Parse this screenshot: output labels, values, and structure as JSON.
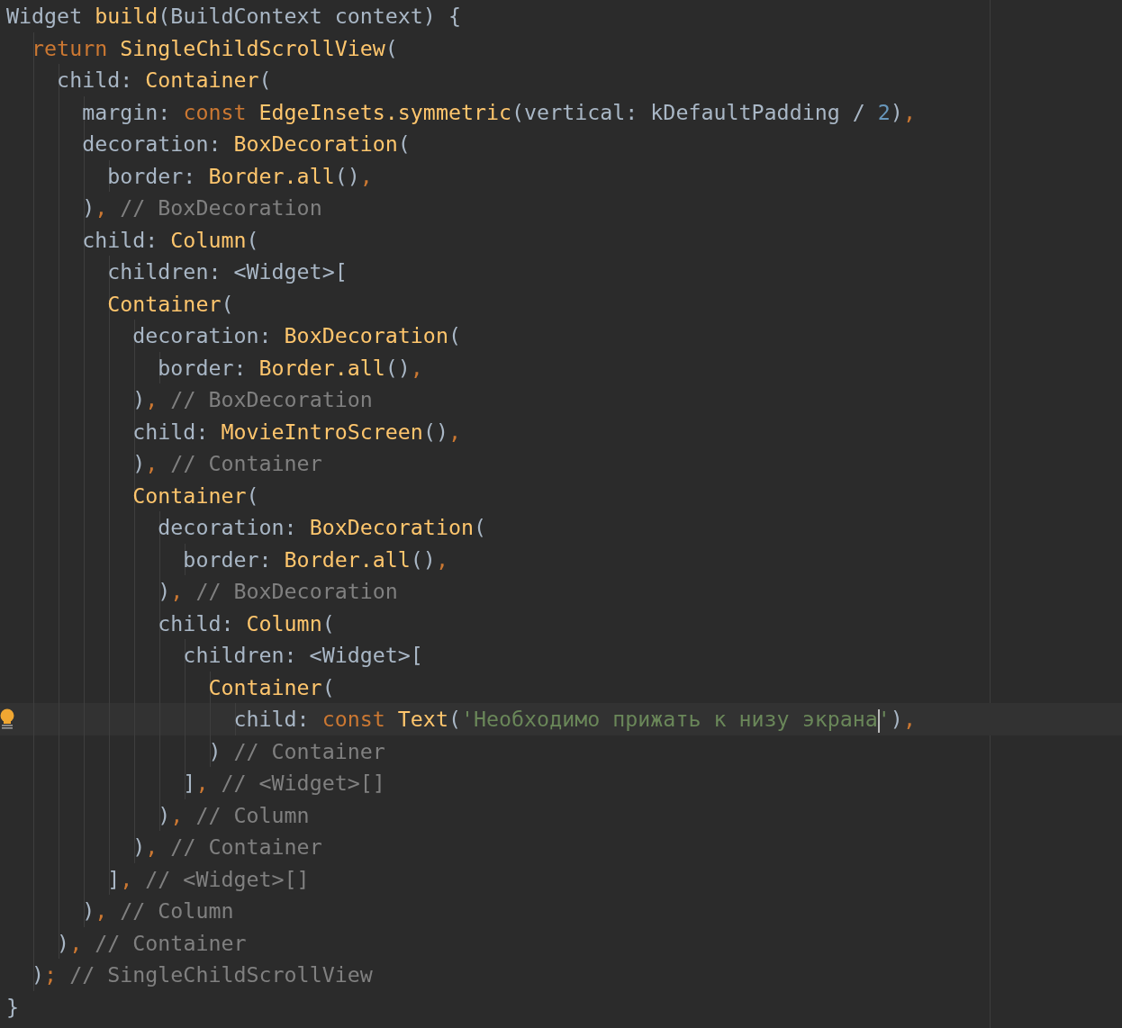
{
  "editor": {
    "lines": [
      {
        "current": false,
        "tokens": [
          {
            "kind": "plain",
            "text": "Widget "
          },
          {
            "kind": "func",
            "text": "build"
          },
          {
            "kind": "plain",
            "text": "(BuildContext context) {"
          }
        ]
      },
      {
        "current": false,
        "tokens": [
          {
            "kind": "kw",
            "text": "  return "
          },
          {
            "kind": "func",
            "text": "SingleChildScrollView"
          },
          {
            "kind": "plain",
            "text": "("
          }
        ]
      },
      {
        "current": false,
        "tokens": [
          {
            "kind": "plain",
            "text": "    child: "
          },
          {
            "kind": "func",
            "text": "Container"
          },
          {
            "kind": "plain",
            "text": "("
          }
        ]
      },
      {
        "current": false,
        "tokens": [
          {
            "kind": "plain",
            "text": "      margin: "
          },
          {
            "kind": "kw",
            "text": "const "
          },
          {
            "kind": "func",
            "text": "EdgeInsets.symmetric"
          },
          {
            "kind": "plain",
            "text": "(vertical: kDefaultPadding / "
          },
          {
            "kind": "num",
            "text": "2"
          },
          {
            "kind": "plain",
            "text": ")"
          },
          {
            "kind": "kw",
            "text": ","
          }
        ]
      },
      {
        "current": false,
        "tokens": [
          {
            "kind": "plain",
            "text": "      decoration: "
          },
          {
            "kind": "func",
            "text": "BoxDecoration"
          },
          {
            "kind": "plain",
            "text": "("
          }
        ]
      },
      {
        "current": false,
        "tokens": [
          {
            "kind": "plain",
            "text": "        border: "
          },
          {
            "kind": "func",
            "text": "Border.all"
          },
          {
            "kind": "plain",
            "text": "()"
          },
          {
            "kind": "kw",
            "text": ","
          }
        ]
      },
      {
        "current": false,
        "tokens": [
          {
            "kind": "plain",
            "text": "      )"
          },
          {
            "kind": "kw",
            "text": ","
          },
          {
            "kind": "comment",
            "text": " // BoxDecoration"
          }
        ]
      },
      {
        "current": false,
        "tokens": [
          {
            "kind": "plain",
            "text": "      child: "
          },
          {
            "kind": "func",
            "text": "Column"
          },
          {
            "kind": "plain",
            "text": "("
          }
        ]
      },
      {
        "current": false,
        "tokens": [
          {
            "kind": "plain",
            "text": "        children: <Widget>["
          }
        ]
      },
      {
        "current": false,
        "tokens": [
          {
            "kind": "func",
            "text": "        Container"
          },
          {
            "kind": "plain",
            "text": "("
          }
        ]
      },
      {
        "current": false,
        "tokens": [
          {
            "kind": "plain",
            "text": "          decoration: "
          },
          {
            "kind": "func",
            "text": "BoxDecoration"
          },
          {
            "kind": "plain",
            "text": "("
          }
        ]
      },
      {
        "current": false,
        "tokens": [
          {
            "kind": "plain",
            "text": "            border: "
          },
          {
            "kind": "func",
            "text": "Border.all"
          },
          {
            "kind": "plain",
            "text": "()"
          },
          {
            "kind": "kw",
            "text": ","
          }
        ]
      },
      {
        "current": false,
        "tokens": [
          {
            "kind": "plain",
            "text": "          )"
          },
          {
            "kind": "kw",
            "text": ","
          },
          {
            "kind": "comment",
            "text": " // BoxDecoration"
          }
        ]
      },
      {
        "current": false,
        "tokens": [
          {
            "kind": "plain",
            "text": "          child: "
          },
          {
            "kind": "func",
            "text": "MovieIntroScreen"
          },
          {
            "kind": "plain",
            "text": "()"
          },
          {
            "kind": "kw",
            "text": ","
          }
        ]
      },
      {
        "current": false,
        "tokens": [
          {
            "kind": "plain",
            "text": "          )"
          },
          {
            "kind": "kw",
            "text": ","
          },
          {
            "kind": "comment",
            "text": " // Container"
          }
        ]
      },
      {
        "current": false,
        "tokens": [
          {
            "kind": "func",
            "text": "          Container"
          },
          {
            "kind": "plain",
            "text": "("
          }
        ]
      },
      {
        "current": false,
        "tokens": [
          {
            "kind": "plain",
            "text": "            decoration: "
          },
          {
            "kind": "func",
            "text": "BoxDecoration"
          },
          {
            "kind": "plain",
            "text": "("
          }
        ]
      },
      {
        "current": false,
        "tokens": [
          {
            "kind": "plain",
            "text": "              border: "
          },
          {
            "kind": "func",
            "text": "Border.all"
          },
          {
            "kind": "plain",
            "text": "()"
          },
          {
            "kind": "kw",
            "text": ","
          }
        ]
      },
      {
        "current": false,
        "tokens": [
          {
            "kind": "plain",
            "text": "            )"
          },
          {
            "kind": "kw",
            "text": ","
          },
          {
            "kind": "comment",
            "text": " // BoxDecoration"
          }
        ]
      },
      {
        "current": false,
        "tokens": [
          {
            "kind": "plain",
            "text": "            child: "
          },
          {
            "kind": "func",
            "text": "Column"
          },
          {
            "kind": "plain",
            "text": "("
          }
        ]
      },
      {
        "current": false,
        "tokens": [
          {
            "kind": "plain",
            "text": "              children: <Widget>["
          }
        ]
      },
      {
        "current": false,
        "tokens": [
          {
            "kind": "func",
            "text": "                Container"
          },
          {
            "kind": "plain",
            "text": "("
          }
        ]
      },
      {
        "current": true,
        "tokens": [
          {
            "kind": "plain",
            "text": "                  child: "
          },
          {
            "kind": "kw",
            "text": "const "
          },
          {
            "kind": "func",
            "text": "Text"
          },
          {
            "kind": "plain",
            "text": "("
          },
          {
            "kind": "str",
            "text": "'Необходимо прижать к низу экрана"
          },
          {
            "kind": "caret"
          },
          {
            "kind": "str",
            "text": "'"
          },
          {
            "kind": "plain",
            "text": ")"
          },
          {
            "kind": "kw",
            "text": ","
          }
        ]
      },
      {
        "current": false,
        "tokens": [
          {
            "kind": "plain",
            "text": "                )"
          },
          {
            "kind": "comment",
            "text": " // Container"
          }
        ]
      },
      {
        "current": false,
        "tokens": [
          {
            "kind": "plain",
            "text": "              ]"
          },
          {
            "kind": "kw",
            "text": ","
          },
          {
            "kind": "comment",
            "text": " // <Widget>[]"
          }
        ]
      },
      {
        "current": false,
        "tokens": [
          {
            "kind": "plain",
            "text": "            )"
          },
          {
            "kind": "kw",
            "text": ","
          },
          {
            "kind": "comment",
            "text": " // Column"
          }
        ]
      },
      {
        "current": false,
        "tokens": [
          {
            "kind": "plain",
            "text": "          )"
          },
          {
            "kind": "kw",
            "text": ","
          },
          {
            "kind": "comment",
            "text": " // Container"
          }
        ]
      },
      {
        "current": false,
        "tokens": [
          {
            "kind": "plain",
            "text": "        ]"
          },
          {
            "kind": "kw",
            "text": ","
          },
          {
            "kind": "comment",
            "text": " // <Widget>[]"
          }
        ]
      },
      {
        "current": false,
        "tokens": [
          {
            "kind": "plain",
            "text": "      )"
          },
          {
            "kind": "kw",
            "text": ","
          },
          {
            "kind": "comment",
            "text": " // Column"
          }
        ]
      },
      {
        "current": false,
        "tokens": [
          {
            "kind": "plain",
            "text": "    )"
          },
          {
            "kind": "kw",
            "text": ","
          },
          {
            "kind": "comment",
            "text": " // Container"
          }
        ]
      },
      {
        "current": false,
        "tokens": [
          {
            "kind": "plain",
            "text": "  )"
          },
          {
            "kind": "kw",
            "text": ";"
          },
          {
            "kind": "comment",
            "text": " // SingleChildScrollView"
          }
        ]
      },
      {
        "current": false,
        "tokens": [
          {
            "kind": "plain",
            "text": "}"
          }
        ]
      }
    ]
  }
}
